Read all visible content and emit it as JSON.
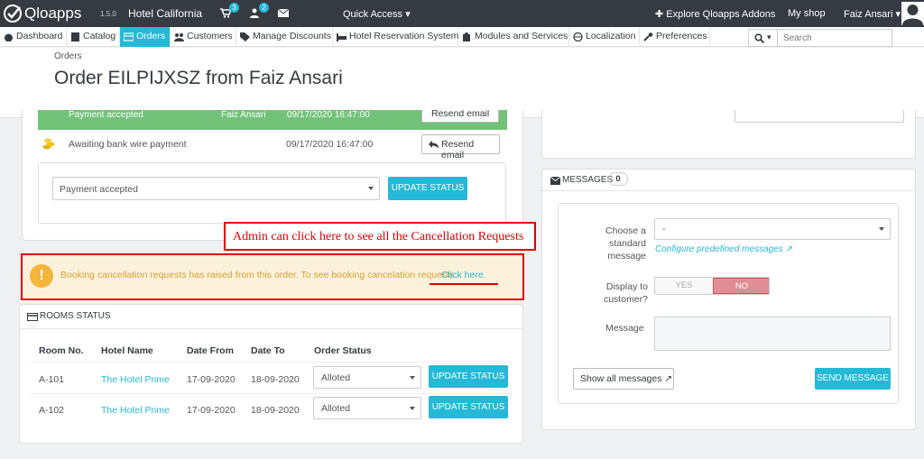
{
  "topbar": {
    "brand": "Qloapps",
    "version": "1.5.0",
    "shop": "Hotel California",
    "cart_badge": "3",
    "user_badge": "2",
    "quick_access": "Quick Access",
    "explore": "Explore Qloapps Addons",
    "my_shop": "My shop",
    "user": "Faiz Ansari"
  },
  "nav": {
    "items": [
      "Dashboard",
      "Catalog",
      "Orders",
      "Customers",
      "Manage Discounts",
      "Hotel Reservation System",
      "Modules and Services",
      "Localization",
      "Preferences"
    ],
    "search_placeholder": "Search"
  },
  "header": {
    "breadcrumb": "Orders",
    "title": "Order EILPIJXSZ from Faiz Ansari"
  },
  "history": {
    "top_row_label": "Payment accepted",
    "top_row_user": "Faiz Ansari",
    "top_row_date": "09/17/2020 16:47:00",
    "top_row_button": "Resend email",
    "status": "Awaiting bank wire payment",
    "date": "09/17/2020 16:47:00",
    "resend": "Resend email",
    "select_value": "Payment accepted",
    "update_status": "UPDATE STATUS"
  },
  "annotation": "Admin can click here to see all the Cancellation Requests",
  "alert": {
    "text": "Booking cancellation requests has raised from this order. To see booking cancelation requests",
    "link": "Click here."
  },
  "rooms": {
    "title": "ROOMS STATUS",
    "headers": [
      "Room No.",
      "Hotel Name",
      "Date From",
      "Date To",
      "Order Status"
    ],
    "rows": [
      {
        "room": "A-101",
        "hotel": "The Hotel Prime",
        "from": "17-09-2020",
        "to": "18-09-2020",
        "status": "Alloted",
        "button": "UPDATE STATUS"
      },
      {
        "room": "A-102",
        "hotel": "The Hotel Prime",
        "from": "17-09-2020",
        "to": "18-09-2020",
        "status": "Alloted",
        "button": "UPDATE STATUS"
      }
    ]
  },
  "messages": {
    "title": "MESSAGES",
    "count": "0",
    "choose_label_1": "Choose a",
    "choose_label_2": "standard",
    "choose_label_3": "message",
    "choose_value": "-",
    "configure_link": "Configure predefined messages",
    "display_label_1": "Display to",
    "display_label_2": "customer?",
    "yes": "YES",
    "no": "NO",
    "message_label": "Message",
    "show_all": "Show all messages",
    "send": "SEND MESSAGE"
  },
  "colors": {
    "accent": "#25b9d7",
    "danger": "#e08e95",
    "success": "#72c279",
    "warning_bg": "#fcf2dc",
    "annotation": "#e10000"
  }
}
